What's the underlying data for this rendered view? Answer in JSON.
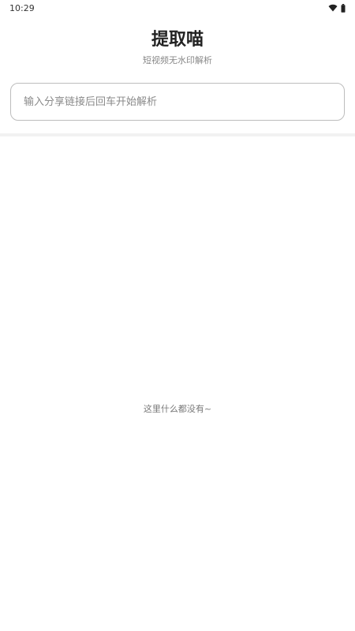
{
  "status_bar": {
    "time": "10:29",
    "icons": [
      "wifi-icon",
      "battery-icon"
    ]
  },
  "header": {
    "title": "提取喵",
    "subtitle": "短视频无水印解析"
  },
  "search": {
    "value": "",
    "placeholder": "输入分享链接后回车开始解析"
  },
  "content": {
    "empty_text": "这里什么都没有~"
  }
}
